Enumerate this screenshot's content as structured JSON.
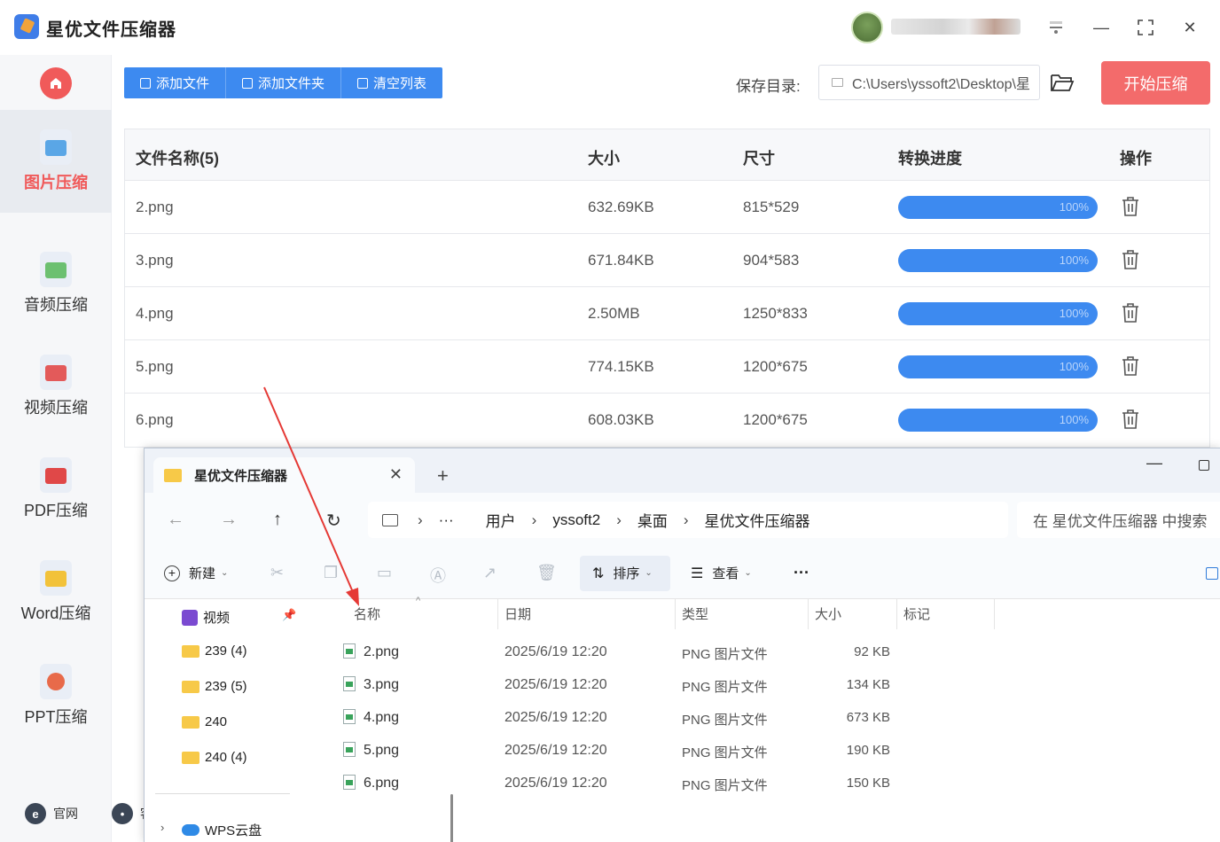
{
  "app": {
    "title": "星优文件压缩器",
    "window": {
      "minimize": "—",
      "maximize": "⛶",
      "close": "✕"
    }
  },
  "sidebar": {
    "items": [
      {
        "label": "图片压缩",
        "icon": "image-icon",
        "color": "#5aa6e6",
        "active": true
      },
      {
        "label": "音频压缩",
        "icon": "music-icon",
        "color": "#6cc070"
      },
      {
        "label": "视频压缩",
        "icon": "video-icon",
        "color": "#e35a5a"
      },
      {
        "label": "PDF压缩",
        "icon": "pdf-icon",
        "color": "#e04848"
      },
      {
        "label": "Word压缩",
        "icon": "word-icon",
        "color": "#f2c23a"
      },
      {
        "label": "PPT压缩",
        "icon": "ppt-icon",
        "color": "#e86a4a"
      }
    ],
    "bottom": {
      "site": "官网",
      "site_badge": "e",
      "service": "客"
    }
  },
  "toolbar": {
    "add_file": "添加文件",
    "add_folder": "添加文件夹",
    "clear_list": "清空列表",
    "save_label": "保存目录:",
    "save_path": "C:\\Users\\yssoft2\\Desktop\\星",
    "start": "开始压缩"
  },
  "table": {
    "headers": {
      "name": "文件名称(5)",
      "size": "大小",
      "dimension": "尺寸",
      "progress": "转换进度",
      "action": "操作"
    },
    "rows": [
      {
        "name": "2.png",
        "size": "632.69KB",
        "dimension": "815*529",
        "progress": "100%"
      },
      {
        "name": "3.png",
        "size": "671.84KB",
        "dimension": "904*583",
        "progress": "100%"
      },
      {
        "name": "4.png",
        "size": "2.50MB",
        "dimension": "1250*833",
        "progress": "100%"
      },
      {
        "name": "5.png",
        "size": "774.15KB",
        "dimension": "1200*675",
        "progress": "100%"
      },
      {
        "name": "6.png",
        "size": "608.03KB",
        "dimension": "1200*675",
        "progress": "100%"
      }
    ]
  },
  "explorer": {
    "tab_title": "星优文件压缩器",
    "breadcrumb": [
      "用户",
      "yssoft2",
      "桌面",
      "星优文件压缩器"
    ],
    "search_placeholder": "在 星优文件压缩器 中搜索",
    "commands": {
      "new": "新建",
      "sort": "排序",
      "view": "查看",
      "more": "···"
    },
    "side_items": [
      "视频",
      "239 (4)",
      "239 (5)",
      "240",
      "240 (4)",
      "WPS云盘"
    ],
    "columns": {
      "name": "名称",
      "date": "日期",
      "type": "类型",
      "size": "大小",
      "tag": "标记"
    },
    "files": [
      {
        "name": "2.png",
        "date": "2025/6/19 12:20",
        "type": "PNG 图片文件",
        "size": "92 KB"
      },
      {
        "name": "3.png",
        "date": "2025/6/19 12:20",
        "type": "PNG 图片文件",
        "size": "134 KB"
      },
      {
        "name": "4.png",
        "date": "2025/6/19 12:20",
        "type": "PNG 图片文件",
        "size": "673 KB"
      },
      {
        "name": "5.png",
        "date": "2025/6/19 12:20",
        "type": "PNG 图片文件",
        "size": "190 KB"
      },
      {
        "name": "6.png",
        "date": "2025/6/19 12:20",
        "type": "PNG 图片文件",
        "size": "150 KB"
      }
    ]
  },
  "colors": {
    "accent_blue": "#3d8af0",
    "accent_red": "#f36b6b",
    "arrow_red": "#e53935"
  }
}
